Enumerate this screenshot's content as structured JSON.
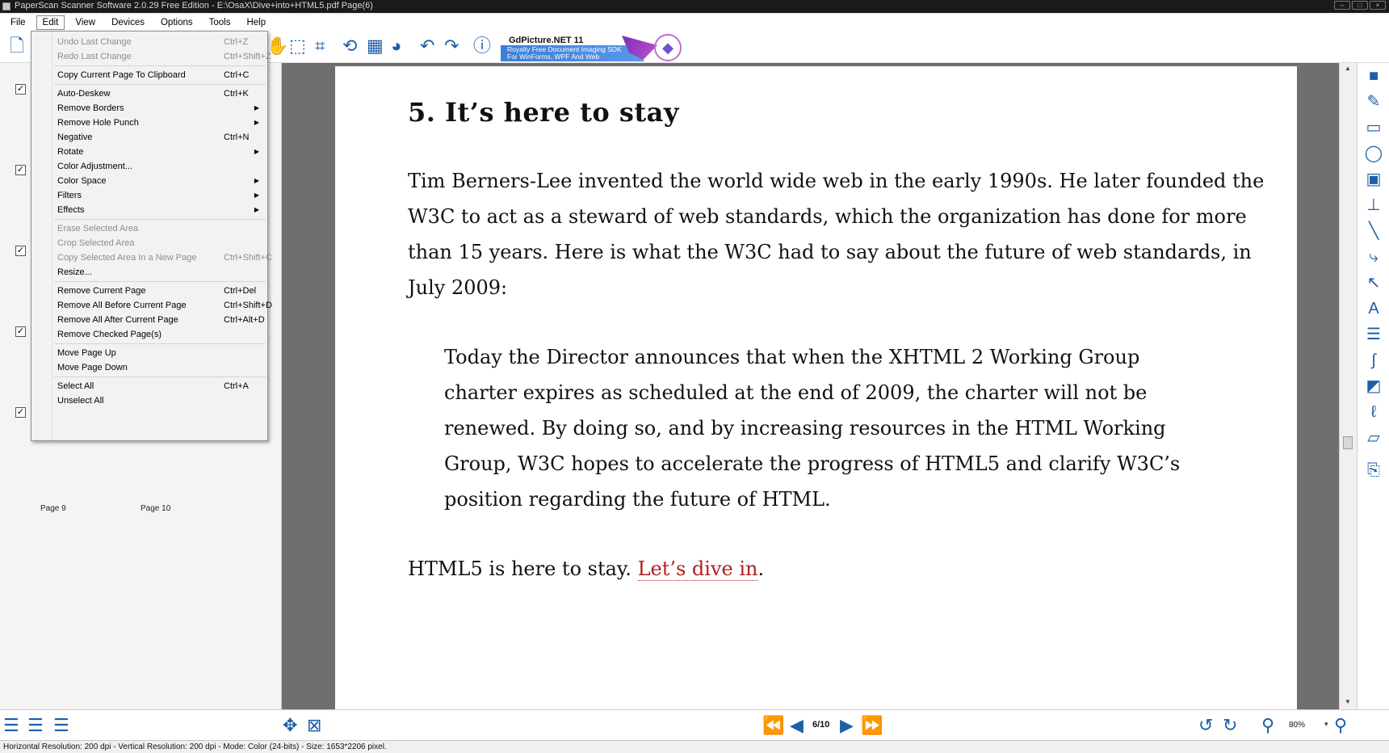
{
  "window": {
    "title": "PaperScan Scanner Software 2.0.29 Free Edition - E:\\OsaX\\Dive+into+HTML5.pdf Page(6)"
  },
  "menubar": [
    "File",
    "Edit",
    "View",
    "Devices",
    "Options",
    "Tools",
    "Help"
  ],
  "edit_menu": [
    {
      "label": "Undo Last Change",
      "shortcut": "Ctrl+Z",
      "disabled": true
    },
    {
      "label": "Redo Last Change",
      "shortcut": "Ctrl+Shift+Z",
      "disabled": true
    },
    {
      "sep": true
    },
    {
      "label": "Copy Current Page To Clipboard",
      "shortcut": "Ctrl+C"
    },
    {
      "sep": true
    },
    {
      "label": "Auto-Deskew",
      "shortcut": "Ctrl+K"
    },
    {
      "label": "Remove Borders",
      "submenu": true
    },
    {
      "label": "Remove Hole Punch",
      "submenu": true
    },
    {
      "label": "Negative",
      "shortcut": "Ctrl+N"
    },
    {
      "label": "Rotate",
      "submenu": true
    },
    {
      "label": "Color Adjustment..."
    },
    {
      "label": "Color Space",
      "submenu": true
    },
    {
      "label": "Filters",
      "submenu": true
    },
    {
      "label": "Effects",
      "submenu": true
    },
    {
      "sep": true
    },
    {
      "label": "Erase Selected Area",
      "disabled": true
    },
    {
      "label": "Crop Selected Area",
      "disabled": true
    },
    {
      "label": "Copy Selected Area In a New Page",
      "shortcut": "Ctrl+Shift+C",
      "disabled": true
    },
    {
      "label": "Resize..."
    },
    {
      "sep": true
    },
    {
      "label": "Remove Current Page",
      "shortcut": "Ctrl+Del"
    },
    {
      "label": "Remove All Before Current Page",
      "shortcut": "Ctrl+Shift+D"
    },
    {
      "label": "Remove All After Current Page",
      "shortcut": "Ctrl+Alt+D"
    },
    {
      "label": "Remove Checked Page(s)"
    },
    {
      "sep": true
    },
    {
      "label": "Move Page Up"
    },
    {
      "label": "Move Page Down"
    },
    {
      "sep": true
    },
    {
      "label": "Select All",
      "shortcut": "Ctrl+A"
    },
    {
      "label": "Unselect All"
    }
  ],
  "banner": {
    "name": "GdPicture.NET 11",
    "line1": "Royalty Free Document Imaging SDK",
    "line2": "For WinForms, WPF And Web"
  },
  "thumbnails": {
    "page_labels": [
      "Page 9",
      "Page 10"
    ],
    "checkmark": "✓"
  },
  "document": {
    "heading": "5. It’s here to stay",
    "paragraph1": [
      "Tim Berners-Lee invented the world wide web in the early 1990s. He later founded the",
      "W3C to act as a steward of web standards, which the organization has done for more",
      "than 15 years. Here is what the W3C had to say about the future of web standards, in",
      "July 2009:"
    ],
    "quote": [
      "Today the Director announces that when the XHTML 2 Working Group",
      "charter expires as scheduled at the end of 2009, the charter will not be",
      "renewed. By doing so, and by increasing resources in the HTML Working",
      "Group, W3C hopes to accelerate the progress of HTML5 and clarify W3C’s",
      "position regarding the future of HTML."
    ],
    "closing_text": "HTML5 is here to stay. ",
    "closing_link": "Let’s dive in",
    "closing_end": ".",
    "link_color": "#b01e1e"
  },
  "navigation": {
    "page_counter": "6/10",
    "zoom": "80%"
  },
  "statusbar": {
    "text": "Horizontal Resolution:  200 dpi - Vertical Resolution:  200 dpi - Mode: Color (24-bits) - Size: 1653*2206 pixel."
  },
  "colors": {
    "accent": "#1d5fa8",
    "viewer_background": "#6f6f6f"
  }
}
